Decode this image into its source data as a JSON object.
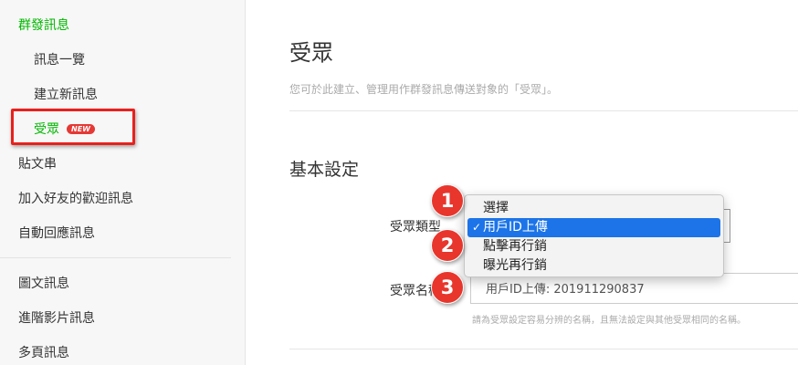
{
  "sidebar": {
    "group_label": "群發訊息",
    "sub_items": [
      "訊息一覽",
      "建立新訊息",
      "受眾"
    ],
    "new_badge": "NEW",
    "top_items": [
      "貼文串",
      "加入好友的歡迎訊息",
      "自動回應訊息"
    ],
    "bottom_items": [
      "圖文訊息",
      "進階影片訊息",
      "多頁訊息"
    ]
  },
  "main": {
    "title": "受眾",
    "description": "您可於此建立、管理用作群發訊息傳送對象的「受眾」。",
    "section_title": "基本設定",
    "type_label": "受眾類型",
    "name_label": "受眾名稱",
    "name_value": "用戶ID上傳: 201911290837",
    "hint": "請為受眾設定容易分辨的名稱，且無法設定與其他受眾相同的名稱。"
  },
  "dropdown": {
    "options": [
      "選擇",
      "用戶ID上傳",
      "點擊再行銷",
      "曝光再行銷"
    ],
    "selected": "用戶ID上傳",
    "check_mark": "✓"
  },
  "steps": [
    "1",
    "2",
    "3"
  ],
  "colors": {
    "accent": "#00b900",
    "highlight": "#e8211d",
    "select": "#1c74e8"
  }
}
